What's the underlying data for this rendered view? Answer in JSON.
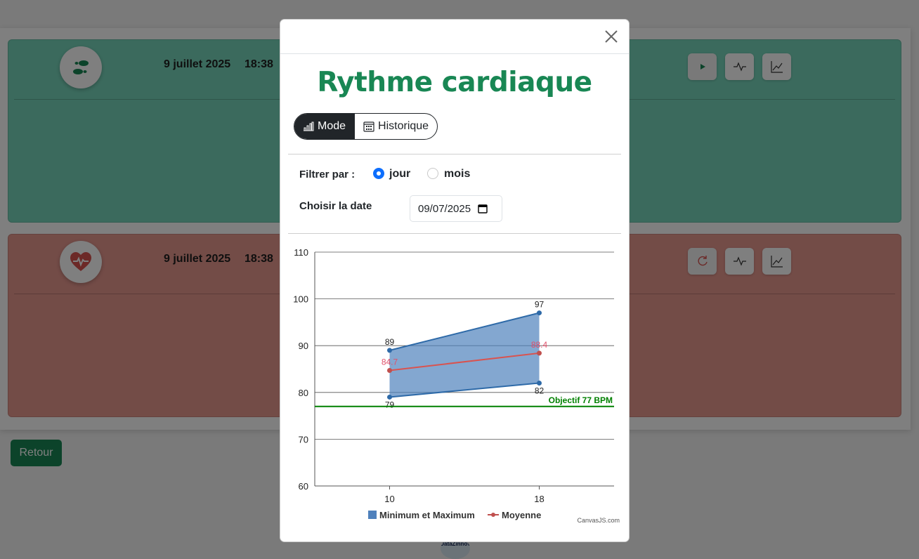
{
  "background": {
    "panels": [
      {
        "name": "steps",
        "date": "9 juillet 2025",
        "time": "18:38",
        "avatar_icon": "footsteps-icon",
        "buttons": [
          "play-icon",
          "activity-icon",
          "chart-line-icon"
        ]
      },
      {
        "name": "heart",
        "date": "9 juillet 2025",
        "time": "18:38",
        "avatar_icon": "heart-pulse-icon",
        "buttons": [
          "refresh-icon",
          "activity-icon",
          "chart-line-icon"
        ]
      }
    ],
    "back_button": "Retour",
    "footer_logo": "DataZinnov"
  },
  "modal": {
    "title": "Rythme cardiaque",
    "tabs": [
      {
        "label": "Mode",
        "icon": "bar-chart-icon",
        "active": true
      },
      {
        "label": "Historique",
        "icon": "calendar-icon",
        "active": false
      }
    ],
    "filter": {
      "label": "Filtrer par :",
      "options": [
        {
          "label": "jour",
          "checked": true
        },
        {
          "label": "mois",
          "checked": false
        }
      ]
    },
    "date_picker": {
      "label": "Choisir la date",
      "value": "09/07/2025"
    }
  },
  "chart_data": {
    "type": "area",
    "x": [
      10,
      18
    ],
    "series": [
      {
        "name": "Minimum et Maximum",
        "type": "rangeArea",
        "color": "#4f81bc",
        "low": [
          79,
          82
        ],
        "high": [
          89,
          97
        ]
      },
      {
        "name": "Moyenne",
        "type": "line",
        "color": "#c0504e",
        "values": [
          84.7,
          88.4
        ]
      }
    ],
    "y_ticks": [
      60,
      70,
      80,
      90,
      100,
      110
    ],
    "x_ticks": [
      10,
      18
    ],
    "ylim": [
      60,
      110
    ],
    "xlim": [
      6,
      22
    ],
    "grid": true,
    "legend_position": "bottom",
    "annotations": [
      {
        "label": "Objectif 77 BPM",
        "y": 77,
        "color": "#008000"
      }
    ],
    "credit": "CanvasJS.com"
  }
}
